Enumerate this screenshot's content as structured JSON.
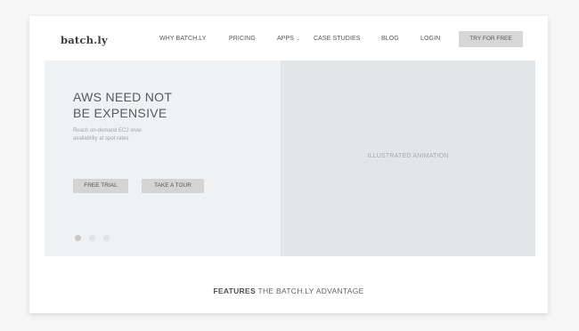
{
  "logo": "batch.ly",
  "nav": {
    "items": [
      {
        "label": "WHY BATCH.LY"
      },
      {
        "label": "PRICING"
      },
      {
        "label": "APPS",
        "caret": "⌄"
      },
      {
        "label": "CASE STUDIES"
      },
      {
        "label": "BLOG"
      },
      {
        "label": "LOGIN"
      }
    ],
    "cta": "TRY FOR FREE"
  },
  "hero": {
    "headline_line1": "AWS NEED NOT",
    "headline_line2": "BE EXPENSIVE",
    "subtext_line1": "Reach on-demand EC2 level",
    "subtext_line2": "availability at spot rates",
    "primary_button": "FREE TRIAL",
    "secondary_button": "TAKE A TOUR",
    "carousel": {
      "count": 3,
      "active_index": 0
    },
    "animation_placeholder": "ILLUSTRATED ANIMATION"
  },
  "features": {
    "title_bold": "FEATURES",
    "title_rest": " THE BATCH.LY ADVANTAGE"
  },
  "colors": {
    "page_bg": "#f6f6f6",
    "hero_left_bg": "#eff1f2",
    "hero_right_bg": "#e3e6e8",
    "button_bg": "#d4d4d4"
  }
}
